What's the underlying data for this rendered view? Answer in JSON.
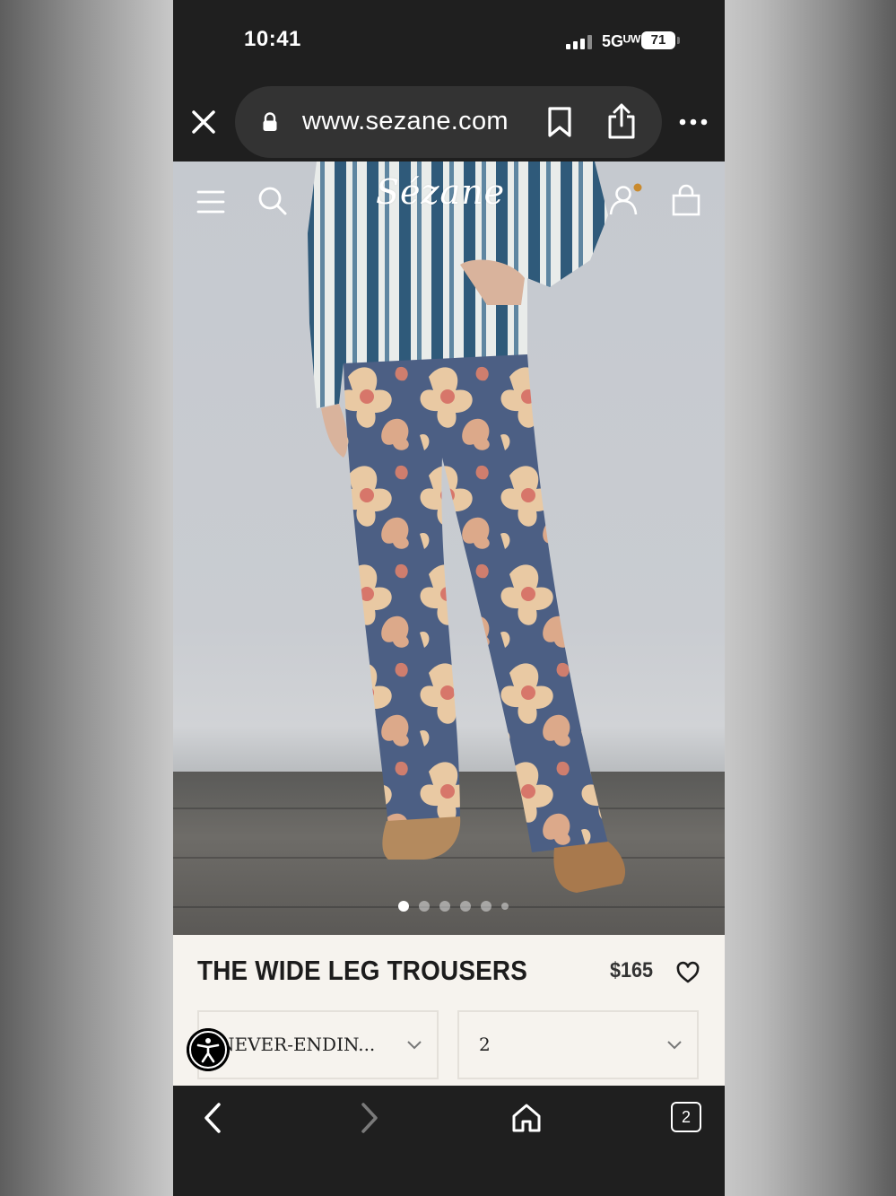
{
  "status_bar": {
    "time": "10:41",
    "network": "5Gᵁᵂ",
    "battery": "71"
  },
  "browser": {
    "url": "www.sezane.com",
    "icons": [
      "close-icon",
      "lock-icon",
      "bookmark-icon",
      "share-icon",
      "more-icon"
    ]
  },
  "site_header": {
    "logo": "Sézane",
    "icons": [
      "menu-icon",
      "search-icon",
      "account-icon",
      "bag-icon"
    ],
    "notification_dot_color": "#c98a2e"
  },
  "gallery": {
    "slide_count": 6,
    "active_slide": 1
  },
  "product": {
    "title": "THE WIDE LEG TROUSERS",
    "price": "$165",
    "color_select": "NEVER-ENDIN...",
    "size_select": "2"
  },
  "bottom_toolbar": {
    "icons": [
      "back-icon",
      "forward-icon",
      "home-icon",
      "tabs-icon"
    ],
    "tab_count": "2"
  }
}
